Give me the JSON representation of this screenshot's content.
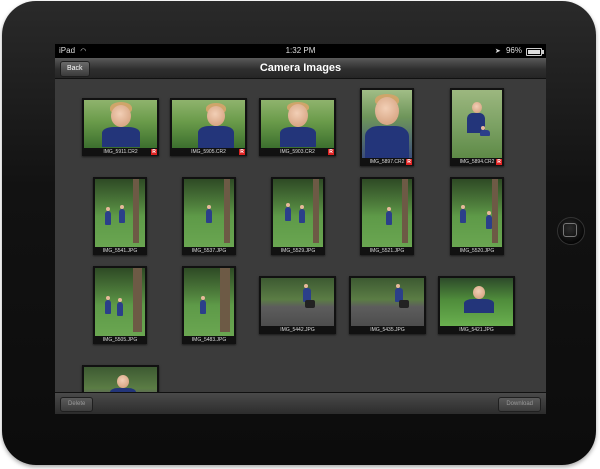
{
  "status_bar": {
    "carrier": "iPad",
    "time": "1:32 PM",
    "battery": "96%",
    "battery_level": 0.96
  },
  "nav": {
    "title": "Camera Images",
    "back_label": "Back"
  },
  "toolbar": {
    "delete_label": "Delete",
    "download_label": "Download"
  },
  "images": [
    {
      "name": "IMG_5911.CR2",
      "raw": true
    },
    {
      "name": "IMG_5905.CR2",
      "raw": true
    },
    {
      "name": "IMG_5903.CR2",
      "raw": true
    },
    {
      "name": "IMG_5897.CR2",
      "raw": true
    },
    {
      "name": "IMG_5894.CR2",
      "raw": true
    },
    {
      "name": "IMG_5541.JPG",
      "raw": false
    },
    {
      "name": "IMG_5537.JPG",
      "raw": false
    },
    {
      "name": "IMG_5529.JPG",
      "raw": false
    },
    {
      "name": "IMG_5521.JPG",
      "raw": false
    },
    {
      "name": "IMG_5520.JPG",
      "raw": false
    },
    {
      "name": "IMG_5505.JPG",
      "raw": false
    },
    {
      "name": "IMG_5483.JPG",
      "raw": false
    },
    {
      "name": "IMG_5442.JPG",
      "raw": false
    },
    {
      "name": "IMG_5435.JPG",
      "raw": false
    },
    {
      "name": "IMG_5421.JPG",
      "raw": false
    },
    {
      "name": "",
      "raw": false
    }
  ]
}
